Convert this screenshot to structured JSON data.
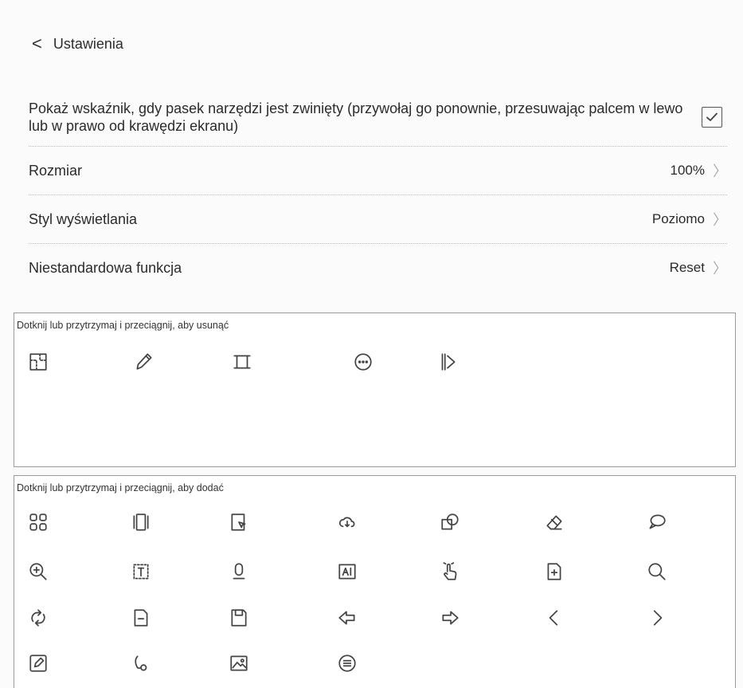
{
  "header": {
    "back_glyph": "<",
    "title": "Ustawienia"
  },
  "settings": {
    "indicator_text": "Pokaż wskaźnik, gdy pasek narzędzi jest zwinięty (przywołaj go ponownie, przesuwając palcem w lewo lub w prawo od krawędzi ekranu)",
    "indicator_checked": true,
    "rows": [
      {
        "label": "Rozmiar",
        "value": "100%"
      },
      {
        "label": "Styl wyświetlania",
        "value": "Poziomo"
      },
      {
        "label": "Niestandardowa funkcja",
        "value": "Reset"
      }
    ]
  },
  "remove_panel": {
    "caption": "Dotknij lub przytrzymaj i przeciągnij, aby usunąć",
    "icons": [
      "screenshot-icon",
      "pen-icon",
      "crop-icon",
      "more-icon",
      "collapse-icon"
    ]
  },
  "add_panel": {
    "caption": "Dotknij lub przytrzymaj i przeciągnij, aby dodać",
    "icons": [
      "apps-grid-icon",
      "multi-page-icon",
      "partial-screenshot-icon",
      "cloud-sync-icon",
      "shape-icon",
      "eraser-icon",
      "comment-icon",
      "zoom-in-icon",
      "text-box-icon",
      "microphone-icon",
      "ai-text-icon",
      "hand-touch-icon",
      "add-page-icon",
      "search-icon",
      "refresh-icon",
      "remove-page-icon",
      "save-icon",
      "back-arrow-icon",
      "forward-arrow-icon",
      "previous-page-icon",
      "next-page-icon",
      "edit-icon",
      "lasso-icon",
      "image-icon",
      "menu-icon"
    ]
  }
}
